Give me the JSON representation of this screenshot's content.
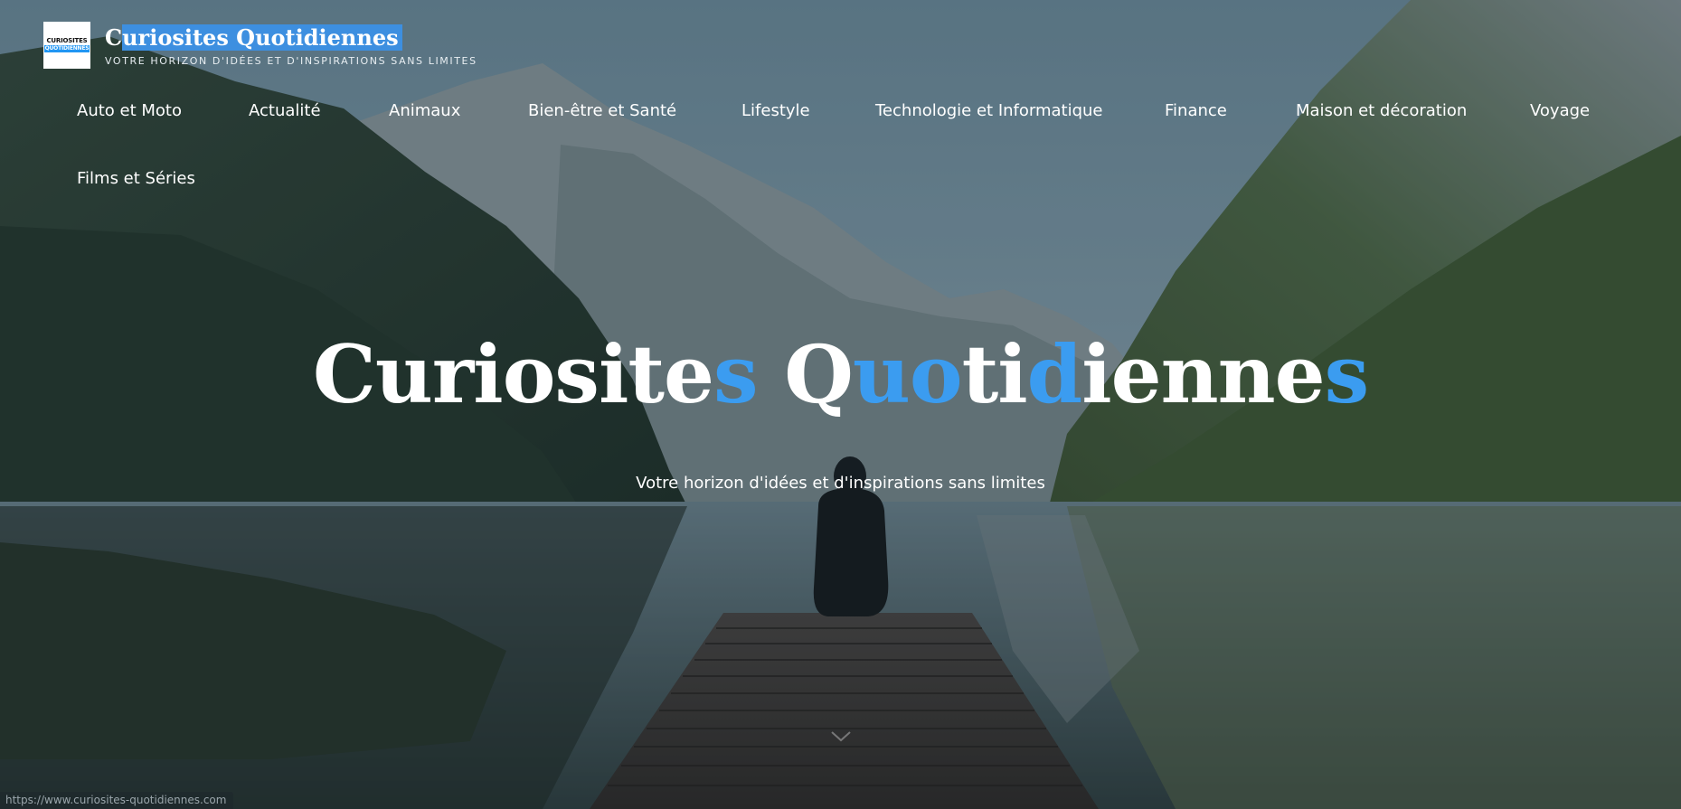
{
  "site": {
    "logo_line1": "CURIOSITES",
    "logo_line2": "QUOTIDIENNES",
    "title": "Curiosites Quotidiennes",
    "tagline": "VOTRE HORIZON D'IDÉES ET D'INSPIRATIONS SANS LIMITES"
  },
  "nav": {
    "items": [
      {
        "label": "Auto et Moto"
      },
      {
        "label": "Actualité"
      },
      {
        "label": "Animaux"
      },
      {
        "label": "Bien-être et Santé"
      },
      {
        "label": "Lifestyle"
      },
      {
        "label": "Technologie et Informatique"
      },
      {
        "label": "Finance"
      },
      {
        "label": "Maison et décoration"
      },
      {
        "label": "Voyage"
      },
      {
        "label": "Films et Séries"
      }
    ]
  },
  "hero": {
    "title": "Curiosites Quotidiennes",
    "subtitle": "Votre horizon d'idées et d'inspirations sans limites"
  },
  "status_bar": {
    "url": "https://www.curiosites-quotidiennes.com"
  },
  "colors": {
    "accent": "#3b9cf0",
    "selection": "#3d8fe0"
  },
  "icons": {
    "scroll": "chevron-down-icon"
  }
}
